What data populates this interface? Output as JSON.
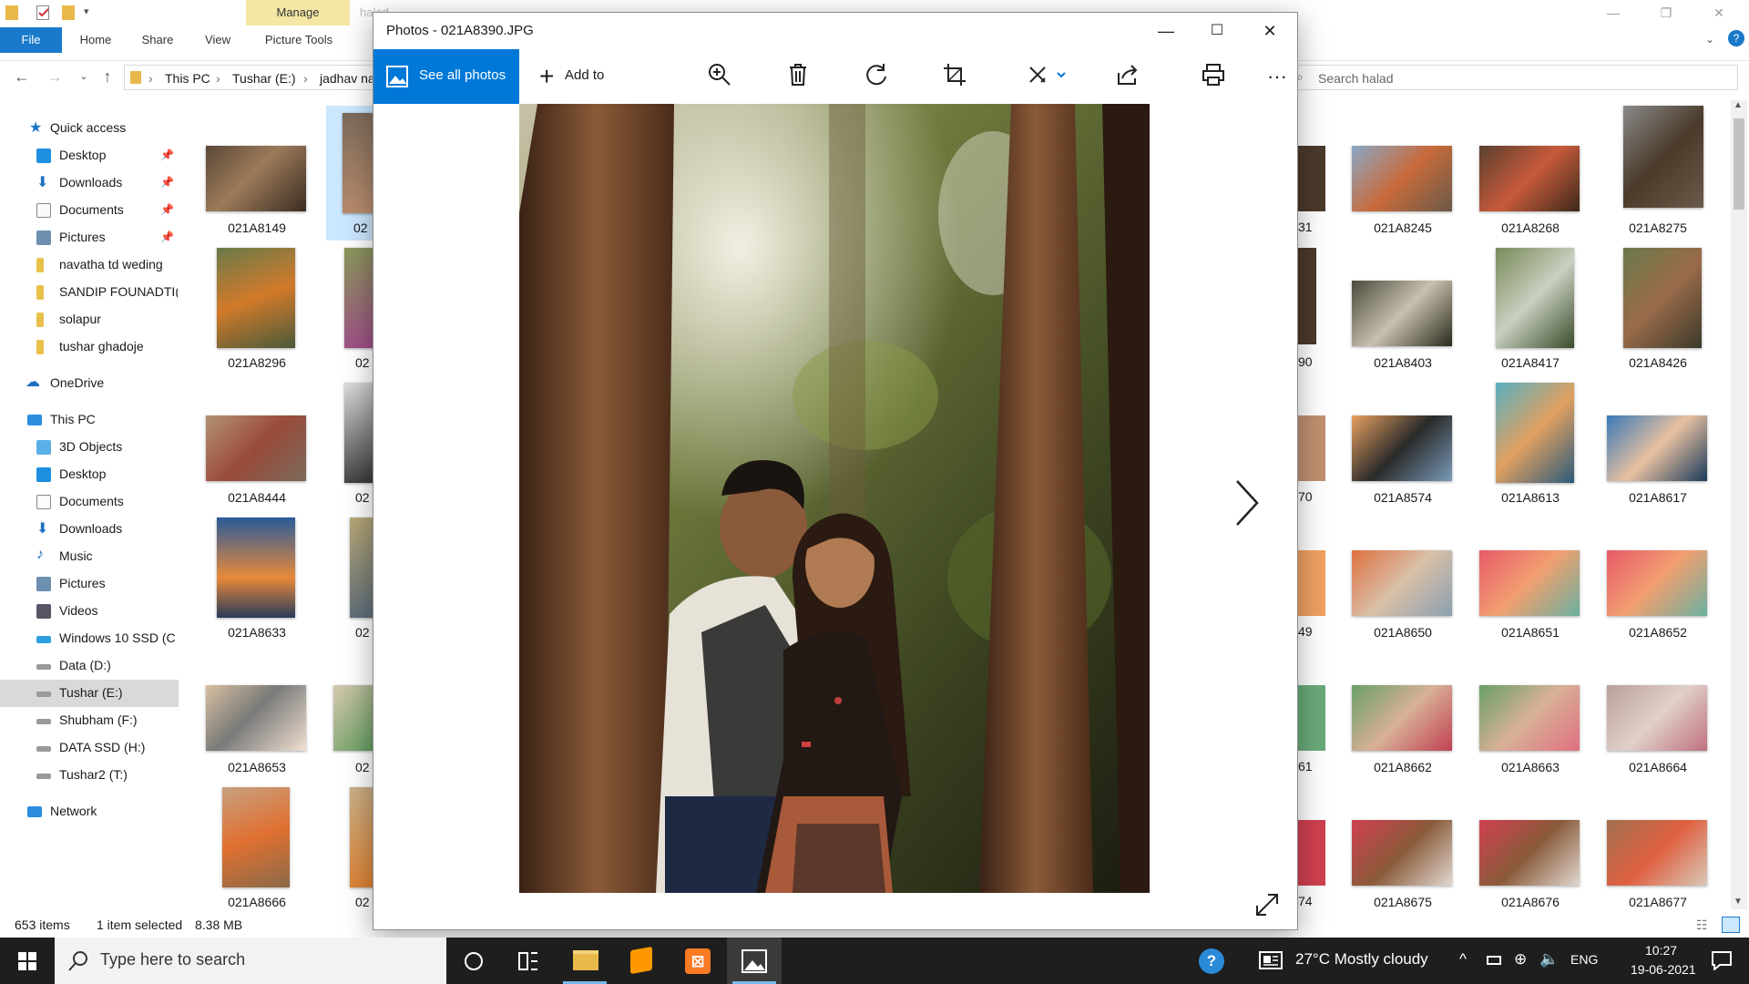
{
  "explorer": {
    "manage_tab": "Manage",
    "window_title_partial": "halad",
    "ribbon_tabs": [
      "File",
      "Home",
      "Share",
      "View",
      "Picture Tools"
    ],
    "breadcrumb": [
      "This PC",
      "Tushar (E:)",
      "jadhav na"
    ],
    "search_placeholder": "Search halad",
    "nav": {
      "quick_access": "Quick access",
      "quick_items": [
        "Desktop",
        "Downloads",
        "Documents",
        "Pictures",
        "navatha td weding",
        "SANDIP FOUNADTI(",
        "solapur",
        "tushar ghadoje"
      ],
      "onedrive": "OneDrive",
      "this_pc": "This PC",
      "pc_items": [
        "3D Objects",
        "Desktop",
        "Documents",
        "Downloads",
        "Music",
        "Pictures",
        "Videos",
        "Windows 10 SSD (C",
        "Data (D:)",
        "Tushar (E:)",
        "Shubham (F:)",
        "DATA SSD (H:)",
        "Tushar2 (T:)"
      ],
      "network": "Network"
    },
    "left_files": [
      [
        "021A8149",
        "02"
      ],
      [
        "021A8296",
        "02"
      ],
      [
        "021A8444",
        "02"
      ],
      [
        "021A8633",
        "02"
      ],
      [
        "021A8653",
        "02"
      ],
      [
        "021A8666",
        "02"
      ]
    ],
    "right_partial": [
      "31",
      "90",
      "70",
      "49",
      "61",
      "74"
    ],
    "right_files": [
      [
        "021A8245",
        "021A8268",
        "021A8275"
      ],
      [
        "021A8403",
        "021A8417",
        "021A8426"
      ],
      [
        "021A8574",
        "021A8613",
        "021A8617"
      ],
      [
        "021A8650",
        "021A8651",
        "021A8652"
      ],
      [
        "021A8662",
        "021A8663",
        "021A8664"
      ],
      [
        "021A8675",
        "021A8676",
        "021A8677"
      ]
    ],
    "status": {
      "count": "653 items",
      "selected": "1 item selected",
      "size": "8.38 MB"
    }
  },
  "photos": {
    "title": "Photos - 021A8390.JPG",
    "see_all": "See all photos",
    "add_to": "Add to",
    "toolbar_icons": [
      "zoom-in-icon",
      "delete-icon",
      "rotate-icon",
      "crop-icon",
      "edit-icon",
      "share-icon",
      "print-icon",
      "more-icon"
    ]
  },
  "taskbar": {
    "search_placeholder": "Type here to search",
    "weather": "27°C  Mostly cloudy",
    "lang": "ENG",
    "time": "10:27",
    "date": "19-06-2021"
  },
  "colors": {
    "accent": "#0078d7",
    "file_tab": "#1979ca",
    "manage_tab": "#f4e7a5",
    "taskbar": "#1e1e1e"
  }
}
